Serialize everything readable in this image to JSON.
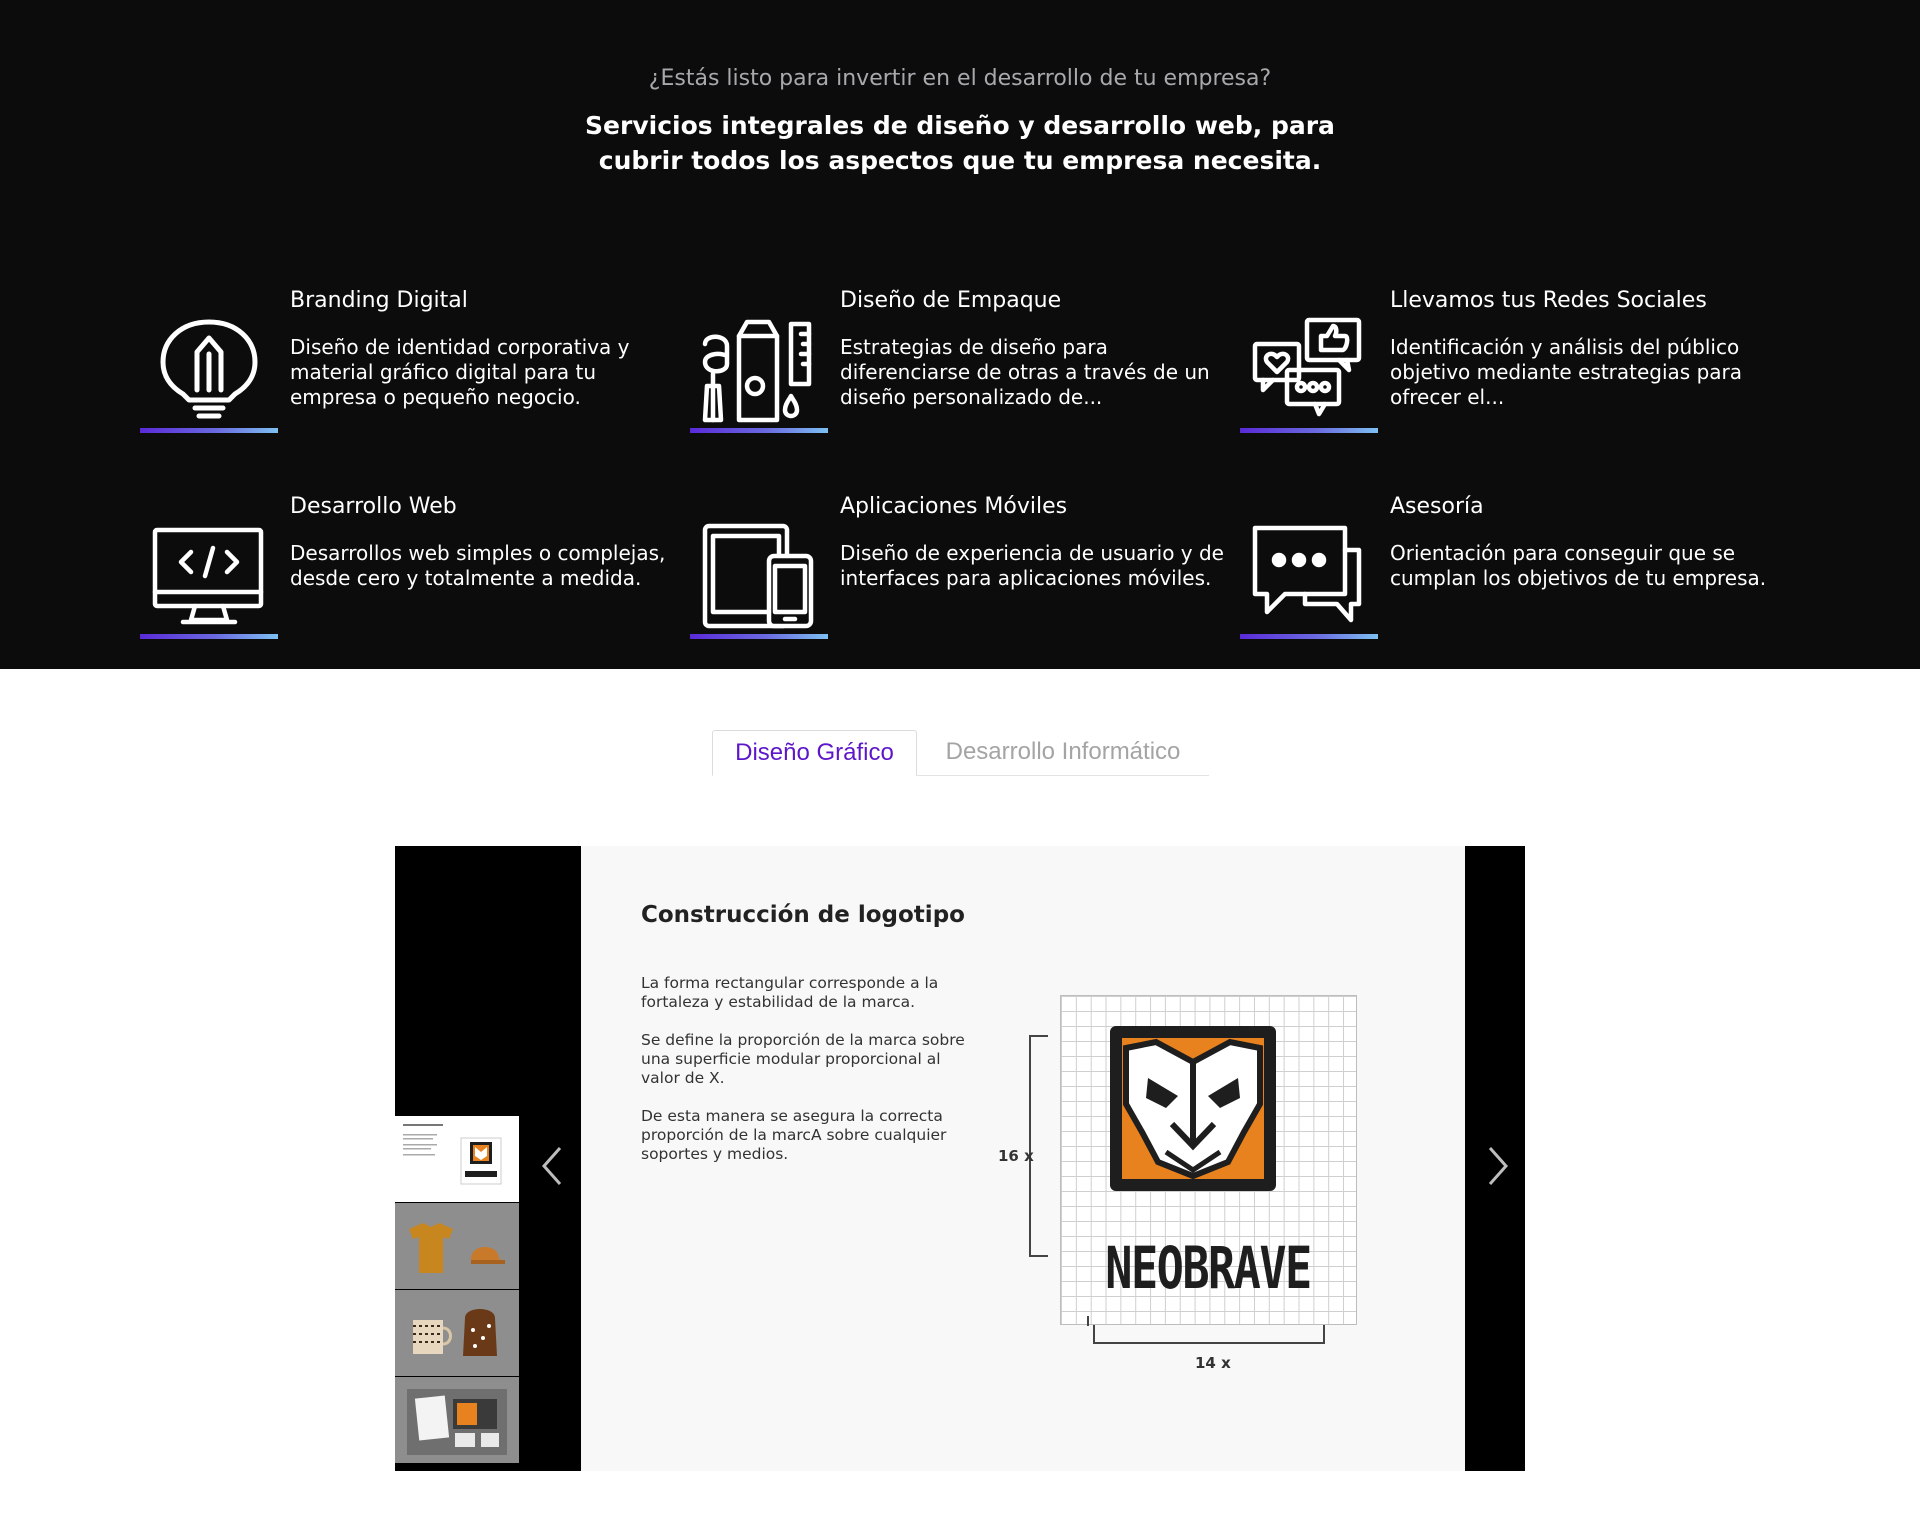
{
  "hero": {
    "subtitle": "¿Estás listo para invertir en el desarrollo de tu empresa?",
    "title": "Servicios integrales de diseño y desarrollo web, para cubrir todos los aspectos que tu empresa necesita."
  },
  "services": [
    {
      "title": "Branding Digital",
      "description": "Diseño de identidad corporativa y material gráfico digital para tu empresa o pequeño negocio.",
      "icon": "lightbulb-icon"
    },
    {
      "title": "Diseño de Empaque",
      "description": "Estrategias de diseño para diferenciarse de otras a través de un diseño personalizado de...",
      "icon": "packaging-icon"
    },
    {
      "title": "Llevamos tus Redes Sociales",
      "description": "Identificación y análisis del público objetivo mediante estrategias para ofrecer el...",
      "icon": "social-media-icon"
    },
    {
      "title": "Desarrollo Web",
      "description": "Desarrollos web simples o complejas, desde cero y totalmente a medida.",
      "icon": "monitor-code-icon"
    },
    {
      "title": "Aplicaciones Móviles",
      "description": "Diseño de experiencia de usuario y de interfaces para aplicaciones móviles.",
      "icon": "devices-icon"
    },
    {
      "title": "Asesoría",
      "description": "Orientación para conseguir que se cumplan los objetivos de tu empresa.",
      "icon": "chat-bubbles-icon"
    }
  ],
  "tabs": {
    "active": "Diseño Gráfico",
    "inactive": "Desarrollo Informático"
  },
  "slide": {
    "title": "Construcción de logotipo",
    "paragraphs": [
      "La forma rectangular corresponde a la fortaleza y estabilidad de la marca.",
      "Se define la proporción de la marca sobre una superficie modular proporcional al valor de X.",
      "De esta manera se asegura la correcta proporción de la marcA sobre cualquier soportes y medios."
    ],
    "height_label": "16 x",
    "width_label": "14 x",
    "brand": "NEOBRAVE"
  },
  "colors": {
    "hero_bg": "#0c0c0d",
    "accent_purple": "#5d16c9",
    "bar_start": "#5a2ad8",
    "bar_end": "#7ec0f2",
    "logo_orange": "#e8821e"
  }
}
